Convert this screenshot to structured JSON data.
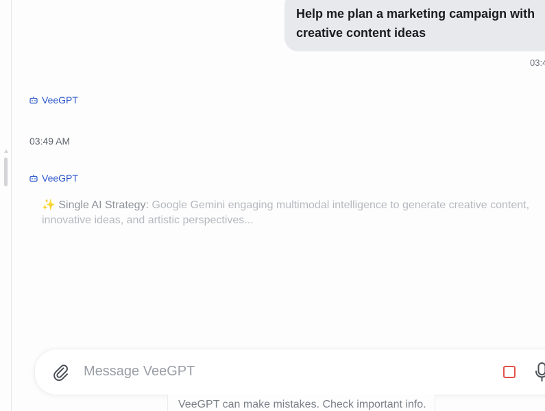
{
  "conversation": {
    "user_message": {
      "text": "Help me plan a marketing campaign with creative content ideas",
      "time": "03:4"
    },
    "assistant_messages": [
      {
        "sender": "VeeGPT",
        "time": "03:49 AM"
      },
      {
        "sender": "VeeGPT",
        "status_icon": "sparkle-icon",
        "status_prefix": "✨ Single AI Strategy:",
        "status_text": "Google Gemini engaging multimodal intelligence to generate creative content, innovative ideas, and artistic perspectives..."
      }
    ]
  },
  "composer": {
    "placeholder": "Message VeeGPT",
    "attach_icon": "paperclip-icon",
    "stop_icon": "stop-icon",
    "mic_icon": "microphone-icon",
    "stop_color": "#e0534a"
  },
  "footer": {
    "disclaimer": "VeeGPT can make mistakes. Check important info."
  },
  "colors": {
    "accent": "#2a55c9",
    "user_bubble": "#e8e9ec"
  }
}
